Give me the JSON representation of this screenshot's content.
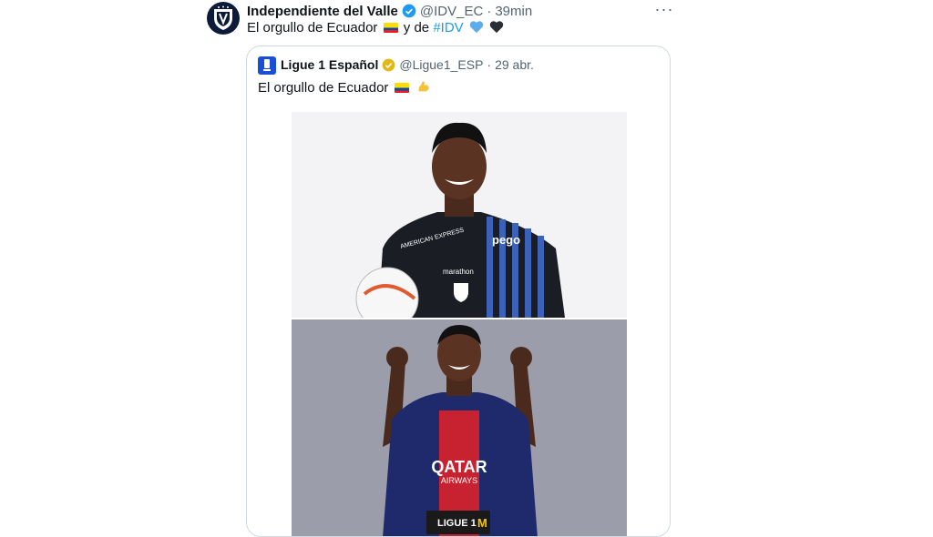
{
  "tweet": {
    "author_name": "Independiente del Valle",
    "handle": "@IDV_EC",
    "separator": "·",
    "time": "39min",
    "text_before": "El orgullo de Ecuador",
    "text_middle": "y de",
    "hashtag": "#IDV",
    "more_label": "···"
  },
  "quote": {
    "author_name": "Ligue 1 Español",
    "handle": "@Ligue1_ESP",
    "separator": "·",
    "date": "29 abr.",
    "text": "El orgullo de Ecuador",
    "photo1_sponsor": "pego",
    "photo1_jersey_brand": "marathon",
    "photo1_chest": "AMERICAN EXPRESS",
    "photo2_sponsor_line1": "QATAR",
    "photo2_sponsor_line2": "AIRWAYS",
    "photo2_badge": "LIGUE 1"
  },
  "colors": {
    "link": "#1d9bf0",
    "text": "#0f1419",
    "muted": "#536471",
    "border": "#cfd9de",
    "verified_blue": "#1d9bf0",
    "verified_gold": "#e2b719"
  },
  "icons": [
    "club-crest-icon",
    "verified-badge-icon",
    "more-options-icon",
    "ecuador-flag-icon",
    "blue-heart-icon",
    "black-heart-icon",
    "ligue1-logo-icon",
    "gold-verified-badge-icon",
    "flexed-biceps-icon"
  ]
}
